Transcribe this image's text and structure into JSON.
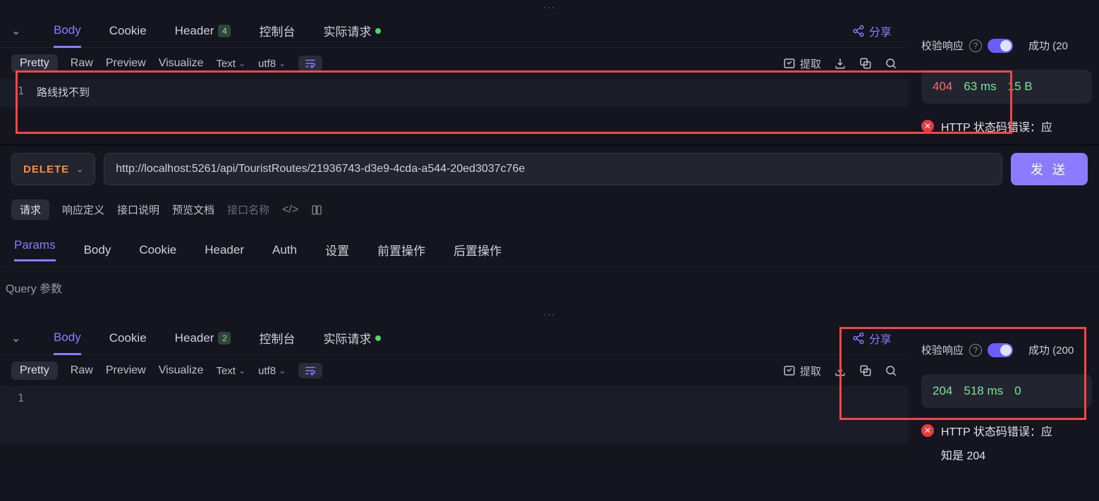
{
  "drag_handle": "···",
  "response1": {
    "tabs": {
      "body": "Body",
      "cookie": "Cookie",
      "header": "Header",
      "header_badge": "4",
      "console": "控制台",
      "actual": "实际请求"
    },
    "share": "分享",
    "format": {
      "pretty": "Pretty",
      "raw": "Raw",
      "preview": "Preview",
      "visualize": "Visualize",
      "type": "Text",
      "encoding": "utf8",
      "extract": "提取"
    },
    "line_no": "1",
    "body_text": "路线找不到",
    "right": {
      "validate": "校验响应",
      "success": "成功 (20",
      "status": "404",
      "time": "63 ms",
      "size": "15 B",
      "error": "HTTP 状态码错误：应"
    }
  },
  "request": {
    "method": "DELETE",
    "url": "http://localhost:5261/api/TouristRoutes/21936743-d3e9-4cda-a544-20ed3037c76e",
    "send": "发 送",
    "sub_tabs": {
      "req": "请求",
      "resp_def": "响应定义",
      "api_doc": "接口说明",
      "preview_doc": "预览文档",
      "api_name_ph": "接口名称"
    },
    "param_tabs": {
      "params": "Params",
      "body": "Body",
      "cookie": "Cookie",
      "header": "Header",
      "auth": "Auth",
      "settings": "设置",
      "pre": "前置操作",
      "post": "后置操作"
    },
    "query_label": "Query 参数"
  },
  "response2": {
    "tabs": {
      "body": "Body",
      "cookie": "Cookie",
      "header": "Header",
      "header_badge": "2",
      "console": "控制台",
      "actual": "实际请求"
    },
    "share": "分享",
    "format": {
      "pretty": "Pretty",
      "raw": "Raw",
      "preview": "Preview",
      "visualize": "Visualize",
      "type": "Text",
      "encoding": "utf8",
      "extract": "提取"
    },
    "line_no": "1",
    "right": {
      "validate": "校验响应",
      "success": "成功 (200",
      "status": "204",
      "time": "518 ms",
      "size": "0",
      "error": "HTTP 状态码错误：应",
      "error2": "知是 204"
    }
  }
}
